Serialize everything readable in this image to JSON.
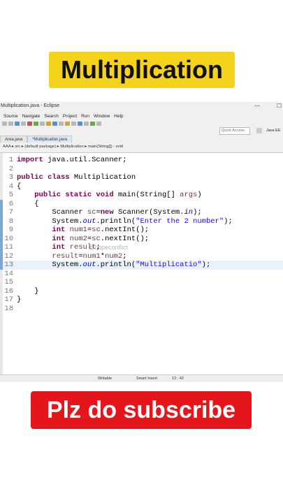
{
  "overlay": {
    "title": "Multiplication",
    "subscribe": "Plz do subscribe",
    "watermark": "@hopeconflict"
  },
  "window": {
    "title": "Multiplication.java - Eclipse",
    "controls": [
      "—",
      "☐"
    ]
  },
  "menu": [
    "Source",
    "Navigate",
    "Search",
    "Project",
    "Run",
    "Window",
    "Help"
  ],
  "toolbar": {
    "quick_access_placeholder": "Quick Access",
    "perspective": "Java EE"
  },
  "tabs": [
    {
      "label": "Area.java",
      "active": false
    },
    {
      "label": "*Multiplication.java",
      "active": true
    }
  ],
  "breadcrumb": "AAA ▸ src ▸ (default package) ▸ Multiplication ▸ main(String[]) : void",
  "code": {
    "line_numbers": [
      "1",
      "2",
      "3",
      "4",
      "5",
      "6",
      "7",
      "8",
      "9",
      "10",
      "11",
      "12",
      "13",
      "14",
      "15",
      "16",
      "17",
      "18"
    ],
    "lines": [
      [
        {
          "t": "import",
          "c": "kw"
        },
        {
          "t": " java.util.Scanner;",
          "c": ""
        }
      ],
      [],
      [
        {
          "t": "public class",
          "c": "kw"
        },
        {
          "t": " Multiplication",
          "c": ""
        }
      ],
      [
        {
          "t": "{",
          "c": ""
        }
      ],
      [
        {
          "t": "    ",
          "c": ""
        },
        {
          "t": "public static void",
          "c": "kw"
        },
        {
          "t": " main(String[] ",
          "c": ""
        },
        {
          "t": "args",
          "c": "var"
        },
        {
          "t": ")",
          "c": ""
        }
      ],
      [
        {
          "t": "    {",
          "c": ""
        }
      ],
      [
        {
          "t": "        Scanner ",
          "c": ""
        },
        {
          "t": "sc",
          "c": "var"
        },
        {
          "t": "=",
          "c": ""
        },
        {
          "t": "new",
          "c": "kw"
        },
        {
          "t": " Scanner(System.",
          "c": ""
        },
        {
          "t": "in",
          "c": "fld"
        },
        {
          "t": ");",
          "c": ""
        }
      ],
      [
        {
          "t": "        System.",
          "c": ""
        },
        {
          "t": "out",
          "c": "fld"
        },
        {
          "t": ".println(",
          "c": ""
        },
        {
          "t": "\"Enter the 2 number\"",
          "c": "str"
        },
        {
          "t": ");",
          "c": ""
        }
      ],
      [
        {
          "t": "        ",
          "c": ""
        },
        {
          "t": "int",
          "c": "kw"
        },
        {
          "t": " ",
          "c": ""
        },
        {
          "t": "num1",
          "c": "var"
        },
        {
          "t": "=",
          "c": ""
        },
        {
          "t": "sc",
          "c": "var"
        },
        {
          "t": ".nextInt();",
          "c": ""
        }
      ],
      [
        {
          "t": "        ",
          "c": ""
        },
        {
          "t": "int",
          "c": "kw"
        },
        {
          "t": " ",
          "c": ""
        },
        {
          "t": "num2",
          "c": "var"
        },
        {
          "t": "=",
          "c": ""
        },
        {
          "t": "sc",
          "c": "var"
        },
        {
          "t": ".nextInt();",
          "c": ""
        }
      ],
      [
        {
          "t": "        ",
          "c": ""
        },
        {
          "t": "int",
          "c": "kw"
        },
        {
          "t": " ",
          "c": ""
        },
        {
          "t": "result",
          "c": "var"
        },
        {
          "t": ";",
          "c": ""
        }
      ],
      [
        {
          "t": "        ",
          "c": ""
        },
        {
          "t": "result",
          "c": "var"
        },
        {
          "t": "=",
          "c": ""
        },
        {
          "t": "num1",
          "c": "var"
        },
        {
          "t": "*",
          "c": ""
        },
        {
          "t": "num2",
          "c": "var"
        },
        {
          "t": ";",
          "c": ""
        }
      ],
      [
        {
          "t": "        System.",
          "c": ""
        },
        {
          "t": "out",
          "c": "fld"
        },
        {
          "t": ".println(",
          "c": ""
        },
        {
          "t": "\"Multiplicatio\"",
          "c": "str"
        },
        {
          "t": ");",
          "c": ""
        }
      ],
      [],
      [],
      [
        {
          "t": "    }",
          "c": ""
        }
      ],
      [
        {
          "t": "}",
          "c": ""
        }
      ],
      []
    ],
    "current_line": 13
  },
  "status": {
    "writable": "Writable",
    "insert_mode": "Smart Insert",
    "position": "13 : 42"
  },
  "colors": {
    "title_banner": "#f5d21c",
    "subscribe_banner": "#e5161b",
    "keyword": "#7f0055",
    "string": "#2a00ff"
  }
}
